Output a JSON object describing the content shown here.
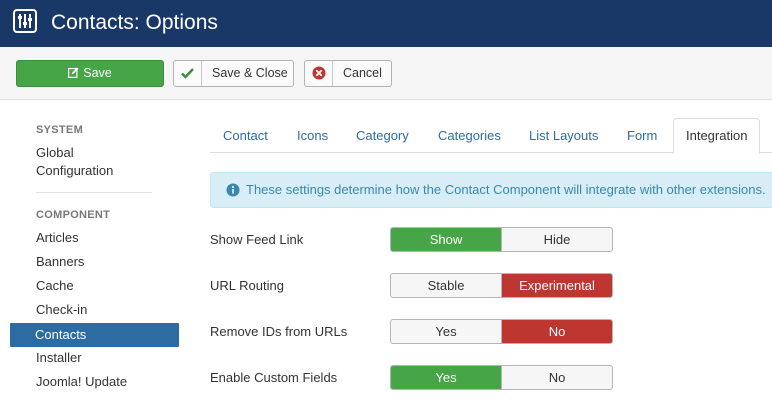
{
  "header": {
    "title": "Contacts: Options"
  },
  "toolbar": {
    "save_label": "Save",
    "save_close_label": "Save & Close",
    "close_label": "Cancel"
  },
  "sidebar": {
    "system_heading": "SYSTEM",
    "global_config": "Global Configuration",
    "component_heading": "COMPONENT",
    "items": [
      "Articles",
      "Banners",
      "Cache",
      "Check-in",
      "Contacts",
      "Installer",
      "Joomla! Update"
    ],
    "active_item": "Contacts"
  },
  "tabs": [
    "Contact",
    "Icons",
    "Category",
    "Categories",
    "List Layouts",
    "Form",
    "Integration"
  ],
  "active_tab": "Integration",
  "alert": {
    "message": "These settings determine how the Contact Component will integrate with other extensions."
  },
  "fields": [
    {
      "label": "Show Feed Link",
      "options": [
        "Show",
        "Hide"
      ],
      "selected": "Show"
    },
    {
      "label": "URL Routing",
      "options": [
        "Stable",
        "Experimental"
      ],
      "selected": "Experimental"
    },
    {
      "label": "Remove IDs from URLs",
      "options": [
        "Yes",
        "No"
      ],
      "selected": "No"
    },
    {
      "label": "Enable Custom Fields",
      "options": [
        "Yes",
        "No"
      ],
      "selected": "Yes"
    }
  ],
  "colors": {
    "header_bg": "#1a3867",
    "green": "#46a546",
    "red": "#bd362f",
    "active_blue": "#2d6ca2",
    "alert_bg": "#d9edf7"
  }
}
